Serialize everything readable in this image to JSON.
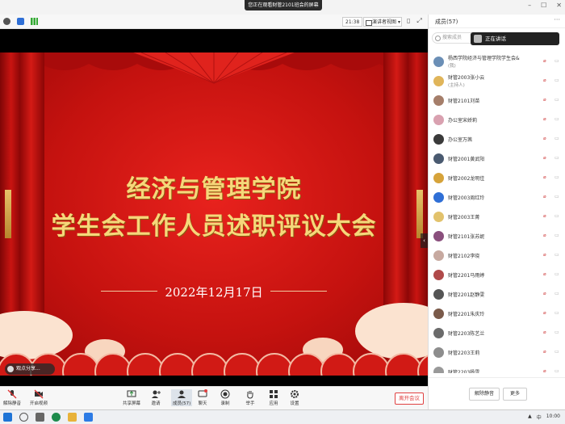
{
  "window": {
    "share_banner": "您正在观看财管2101班会的屏幕",
    "min": "–",
    "max": "☐",
    "close": "✕"
  },
  "toptoolbar": {
    "time": "21:38",
    "view_label": "演讲者视图",
    "view_caret": "▾",
    "layout_icon": "▯",
    "fullscreen_icon": "⤢"
  },
  "slide": {
    "title_line1": "经济与管理学院",
    "title_line2": "学生会工作人员述职评议大会",
    "date": "2022年12月17日",
    "speaker_tag": "观点分享...",
    "side_arrow": "‹"
  },
  "bottombar": {
    "items": [
      {
        "label": "解除静音"
      },
      {
        "label": "开启视频"
      },
      {
        "label": "共享屏幕"
      },
      {
        "label": "邀请"
      },
      {
        "label": "成员(57)"
      },
      {
        "label": "聊天"
      },
      {
        "label": "录制"
      },
      {
        "label": "举手"
      },
      {
        "label": "应用"
      },
      {
        "label": "设置"
      }
    ],
    "leave": "离开会议"
  },
  "panel": {
    "title": "成员(57)",
    "more": "···",
    "search_placeholder": "搜索成员",
    "speaking_label": "正在讲话",
    "members": [
      {
        "name": "杨西学院经济与管理学院学生会&",
        "role": "(我)",
        "color": "#6b8fb6"
      },
      {
        "name": "财管2003张小云",
        "role": "(主持人)",
        "color": "#e0b55a"
      },
      {
        "name": "财管2101刘苗",
        "role": "",
        "color": "#a57e6a"
      },
      {
        "name": "办公室宋娇莉",
        "role": "",
        "color": "#d9a1b0"
      },
      {
        "name": "办公室万茜",
        "role": "",
        "color": "#3a3a3a"
      },
      {
        "name": "财管2001黄武阳",
        "role": "",
        "color": "#4a5a70"
      },
      {
        "name": "财管2002龙明佳",
        "role": "",
        "color": "#d6a33a"
      },
      {
        "name": "财管2003周红玲",
        "role": "",
        "color": "#2f6fd6"
      },
      {
        "name": "财管2003王菁",
        "role": "",
        "color": "#e2c26c"
      },
      {
        "name": "财管2101张苏妮",
        "role": "",
        "color": "#8a4f7d"
      },
      {
        "name": "财管2102李晓",
        "role": "",
        "color": "#c7a9a0"
      },
      {
        "name": "财管2201马雨婷",
        "role": "",
        "color": "#b04a4a"
      },
      {
        "name": "财管2201赵静雯",
        "role": "",
        "color": "#555555"
      },
      {
        "name": "财管2201朱庆玲",
        "role": "",
        "color": "#7a5a4a"
      },
      {
        "name": "财管2203陈艺兰",
        "role": "",
        "color": "#6b6b6b"
      },
      {
        "name": "财管2203王莉",
        "role": "",
        "color": "#8d8d8d"
      },
      {
        "name": "财管2203杨雪",
        "role": "",
        "color": "#999999"
      }
    ],
    "unmute_all": "解除静音",
    "more_btn": "更多"
  },
  "taskbar": {
    "tray_lang": "中",
    "tray_time": "10:00"
  },
  "colors": {
    "accent_red": "#e04040",
    "slide_gold": "#f6d77a"
  }
}
